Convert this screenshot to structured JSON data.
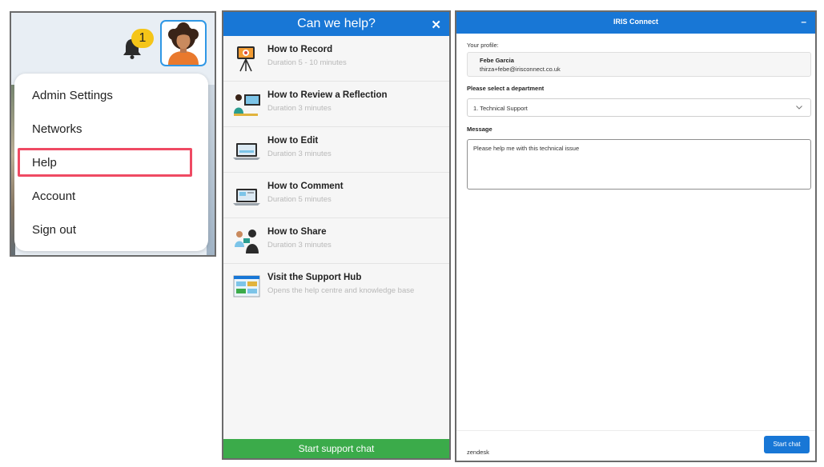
{
  "account_menu": {
    "notification_count": "1",
    "items": [
      {
        "label": "Admin Settings"
      },
      {
        "label": "Networks"
      },
      {
        "label": "Help"
      },
      {
        "label": "Account"
      },
      {
        "label": "Sign out"
      }
    ],
    "highlighted_item": "Help",
    "highlight_color": "#ef4a63"
  },
  "help_panel": {
    "title": "Can we help?",
    "close_icon": "close-icon",
    "header_color": "#1877d6",
    "items": [
      {
        "title": "How to Record",
        "subtitle": "Duration 5 - 10 minutes",
        "icon": "record-tripod-icon"
      },
      {
        "title": "How to Review a Reflection",
        "subtitle": "Duration 3 minutes",
        "icon": "review-reflection-icon"
      },
      {
        "title": "How to Edit",
        "subtitle": "Duration 3 minutes",
        "icon": "edit-laptop-icon"
      },
      {
        "title": "How to Comment",
        "subtitle": "Duration 5 minutes",
        "icon": "comment-laptop-icon"
      },
      {
        "title": "How to Share",
        "subtitle": "Duration 3 minutes",
        "icon": "share-people-icon"
      },
      {
        "title": "Visit the Support Hub",
        "subtitle": "Opens the help centre and knowledge base",
        "icon": "support-hub-icon"
      }
    ],
    "chat_button": "Start support chat",
    "chat_color": "#3bab4a"
  },
  "chat_widget": {
    "title": "IRIS Connect",
    "minimize_label": "–",
    "profile_label": "Your profile:",
    "profile_name": "Febe Garcia",
    "profile_email": "thirza+febe@irisconnect.co.uk",
    "department_label": "Please select a department",
    "department_value": "1. Technical Support",
    "message_label": "Message",
    "message_value": "Please help me with this technical issue",
    "footer_brand": "zendesk",
    "start_button": "Start chat"
  }
}
